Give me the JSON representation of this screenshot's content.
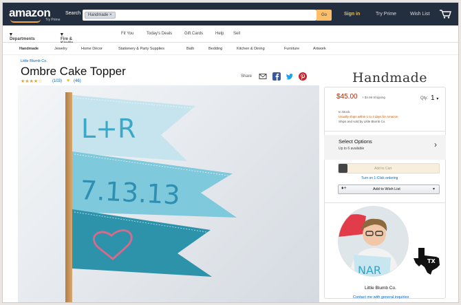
{
  "header": {
    "logo": "amazon",
    "logo_tag": "Try Prime",
    "search_label": "Search",
    "search_chip": "Handmade",
    "search_button": "Go",
    "sign_in": "Sign in",
    "try_prime": "Try Prime",
    "wish_list": "Wish List"
  },
  "subnav": {
    "departments": "Departments",
    "fire_kindle": "Fire & Kindle",
    "links": [
      "Fit You",
      "Today's Deals",
      "Gift Cards",
      "Help",
      "Sell"
    ]
  },
  "category_nav": {
    "items": [
      "Handmade",
      "Jewelry",
      "Home Décor",
      "Stationery & Party Supplies",
      "Bath",
      "Bedding",
      "Kitchen & Dining",
      "Furniture",
      "Artwork"
    ]
  },
  "product": {
    "shop_link": "Little Blumb Co.",
    "title": "Ombre Cake Topper",
    "stars": "★★★★☆",
    "reviews": "(103)",
    "favorites": "(46)",
    "share_label": "Share",
    "flag_texts": [
      "L+R",
      "7.13.13"
    ],
    "colors": {
      "flag_light": "#c6e4ee",
      "flag_mid": "#7ec9dc",
      "flag_dark": "#2c93ab",
      "stitch": "#3aa9c8",
      "heart": "#d26b8c"
    }
  },
  "handmade_brand": "Handmade",
  "buybox": {
    "price": "$45.00",
    "shipping": "+ $4.99 Shipping",
    "qty_label": "Qty:",
    "qty_value": "1",
    "in_stock": "In Stock.",
    "want_it": "Usually ships within 1 to 3 days for Amazon",
    "sold_by": "Ships and sold by Little Blumb Co.",
    "options_title": "Select Options",
    "options_sub": "Up to 6 available",
    "add_to_cart": "Add to Cart",
    "one_click": "Turn on 1-Click ordering",
    "add_to_wish": "Add to Wish List"
  },
  "seller": {
    "name": "Little Blumb Co.",
    "contact": "Contact me with general inquiries",
    "badge": "TX",
    "colors": {
      "state_badge": "#111111"
    }
  }
}
